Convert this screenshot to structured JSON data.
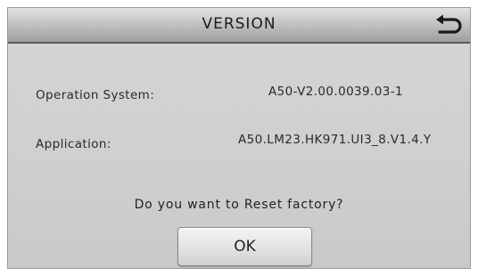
{
  "header": {
    "title": "VERSION",
    "back_icon": "return-arrow-icon"
  },
  "info": {
    "os_label": "Operation System:",
    "os_value": "A50-V2.00.0039.03-1",
    "app_label": "Application:",
    "app_value": "A50.LM23.HK971.UI3_8.V1.4.Y"
  },
  "reset": {
    "prompt": "Do you want to Reset factory?",
    "ok_label": "OK"
  }
}
